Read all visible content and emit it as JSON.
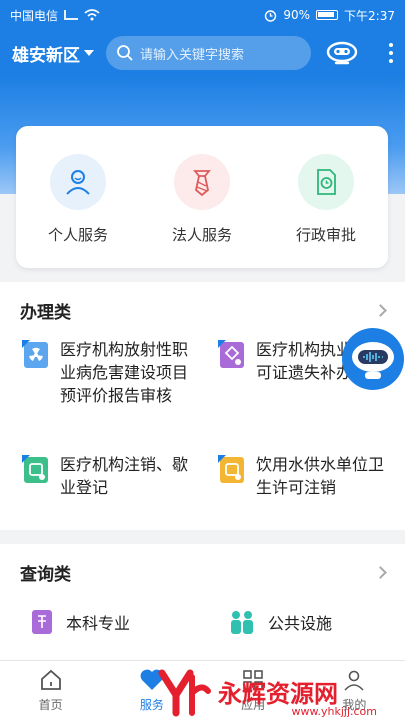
{
  "status": {
    "carrier": "中国电信",
    "battery": "90%",
    "time": "下午2:37"
  },
  "header": {
    "city": "雄安新区",
    "search_placeholder": "请输入关键字搜索"
  },
  "services": [
    {
      "label": "个人服务"
    },
    {
      "label": "法人服务"
    },
    {
      "label": "行政审批"
    }
  ],
  "sections": {
    "handle": {
      "title": "办理类",
      "items": [
        {
          "label": "医疗机构放射性职业病危害建设项目预评价报告审核"
        },
        {
          "label": "医疗机构执业许可证遗失补办"
        },
        {
          "label": "医疗机构注销、歇业登记"
        },
        {
          "label": "饮用水供水单位卫生许可注销"
        }
      ]
    },
    "query": {
      "title": "查询类",
      "items": [
        {
          "label": "本科专业"
        },
        {
          "label": "公共设施"
        }
      ]
    }
  },
  "tabs": [
    {
      "label": "首页"
    },
    {
      "label": "服务"
    },
    {
      "label": "应用"
    },
    {
      "label": "我的"
    }
  ],
  "watermark": {
    "text": "永辉资源网",
    "url": "www.yhkjjj.com"
  },
  "colors": {
    "primary": "#1d7fe3",
    "watermark": "#e4202e"
  }
}
